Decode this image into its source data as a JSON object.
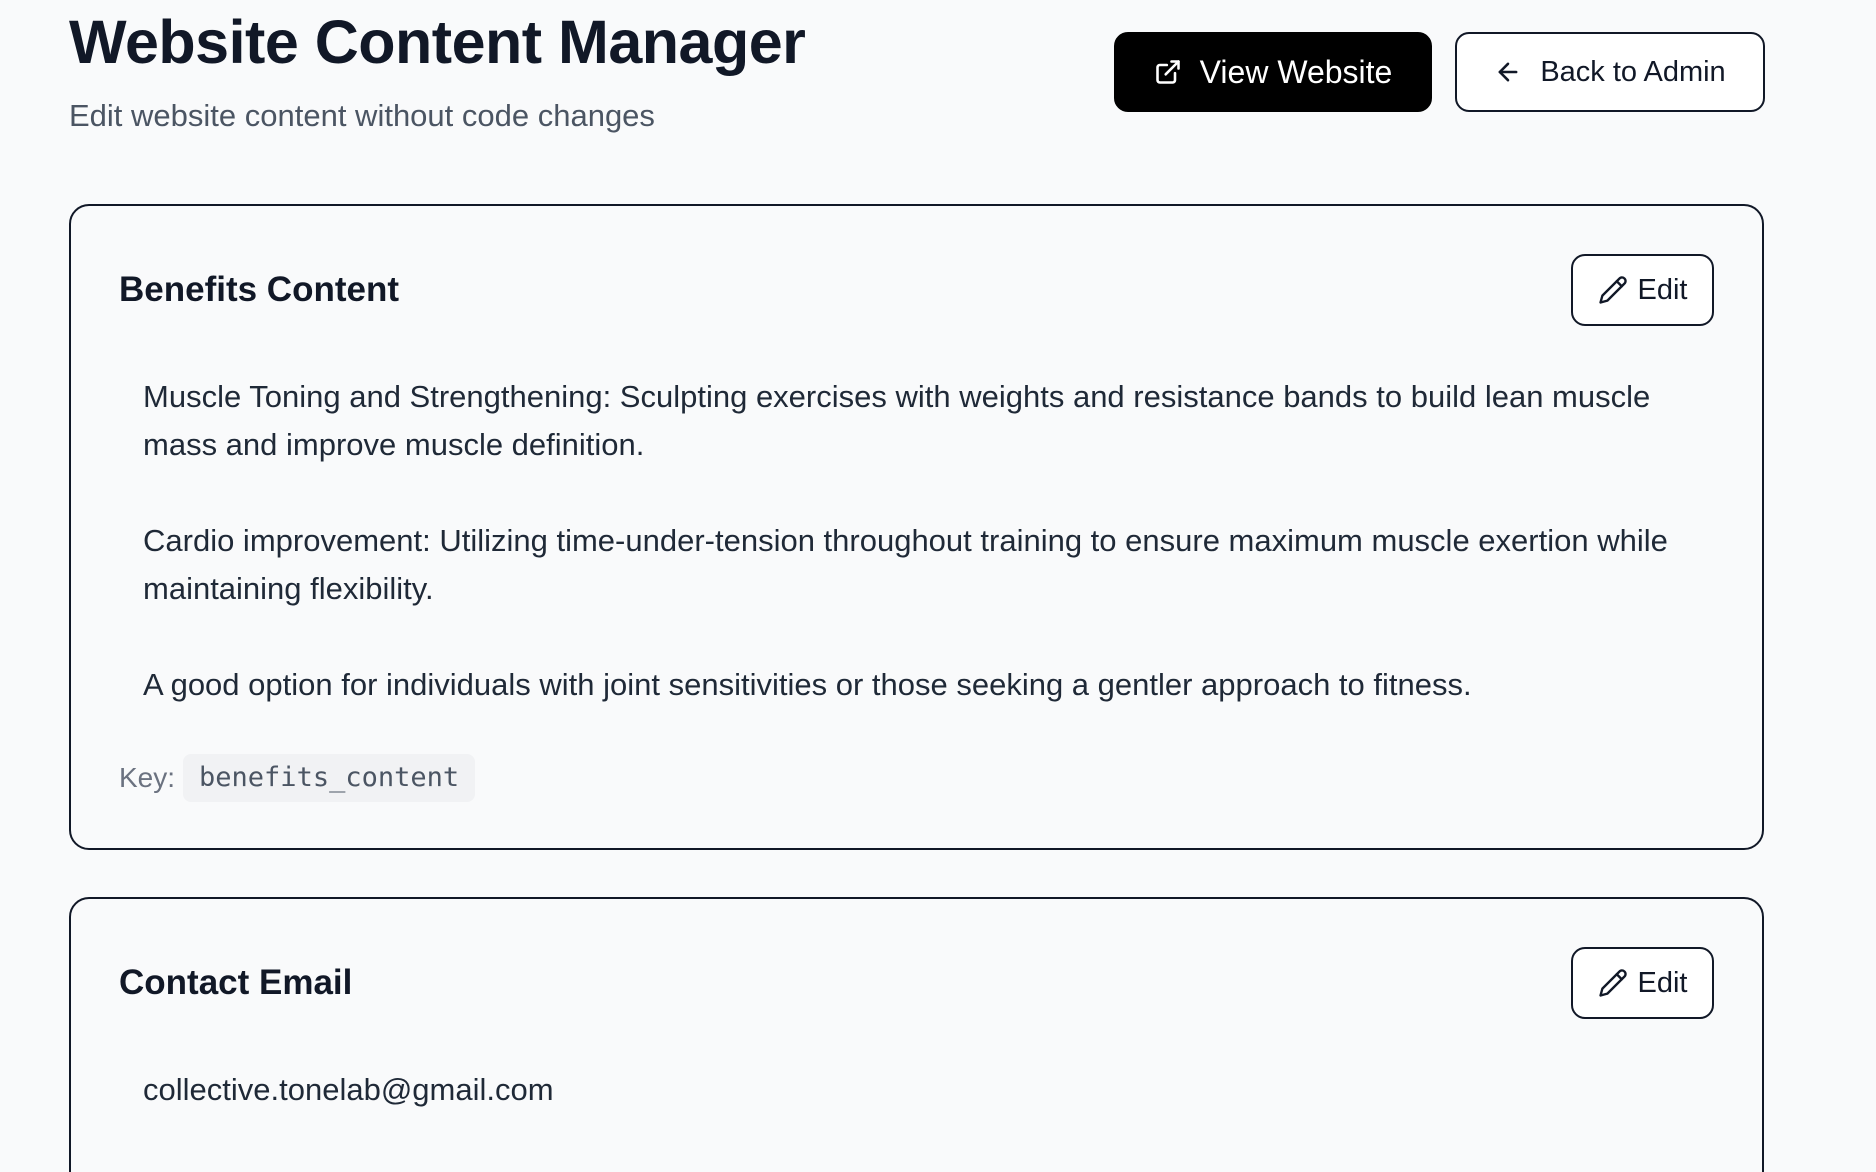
{
  "header": {
    "title": "Website Content Manager",
    "subtitle": "Edit website content without code changes",
    "view_website_label": "View Website",
    "back_to_admin_label": "Back to Admin"
  },
  "icons": {
    "view_website": "external-link-icon",
    "back_to_admin": "arrow-left-icon",
    "edit": "pencil-icon"
  },
  "cards": [
    {
      "title": "Benefits Content",
      "edit_label": "Edit",
      "paragraphs": [
        "Muscle Toning and Strengthening: Sculpting exercises with weights and resistance bands to build lean muscle mass and improve muscle definition.",
        "Cardio improvement: Utilizing time-under-tension throughout training to ensure maximum muscle exertion while maintaining flexibility.",
        "A good option for individuals with joint sensitivities or those seeking a gentler approach to fitness."
      ],
      "key_label": "Key:",
      "key_value": "benefits_content"
    },
    {
      "title": "Contact Email",
      "edit_label": "Edit",
      "paragraphs": [
        "collective.tonelab@gmail.com"
      ]
    }
  ],
  "colors": {
    "background": "#f9fafb",
    "primary_button": "#000000",
    "text_primary": "#111827",
    "text_muted": "#4b5563"
  }
}
